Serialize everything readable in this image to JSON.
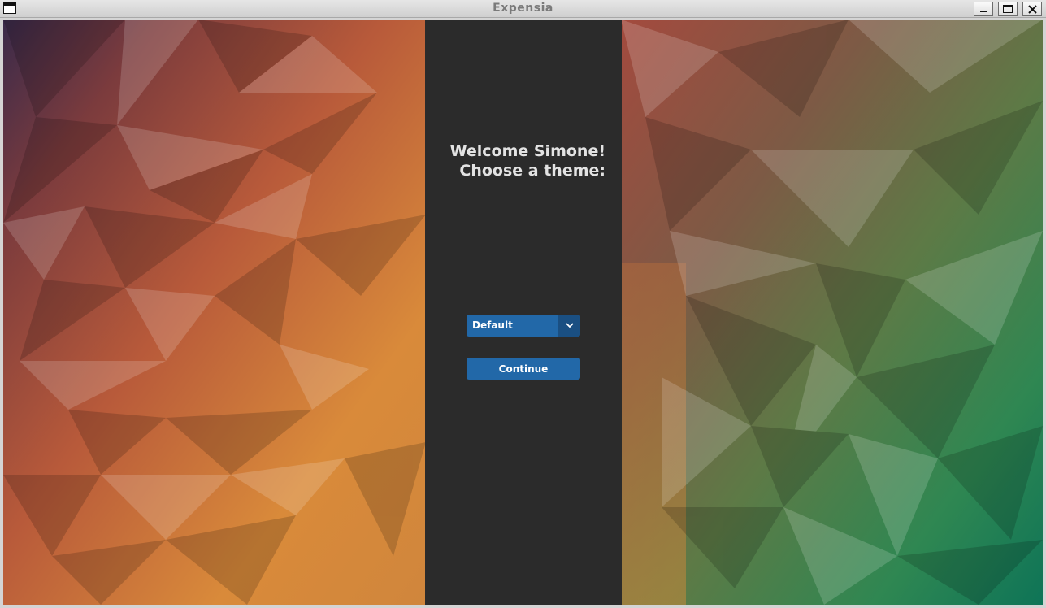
{
  "window": {
    "title": "Expensia",
    "controls": [
      "minimize-icon",
      "maximize-icon",
      "close-icon"
    ]
  },
  "welcome": {
    "line1": "Welcome Simone!",
    "line2": "Choose a theme:"
  },
  "theme_select": {
    "selected": "Default",
    "icon": "chevron-down-icon"
  },
  "continue_button": {
    "label": "Continue"
  },
  "colors": {
    "panel": "#2b2b2b",
    "accent": "#2268a8",
    "accent_dark": "#1a4f82",
    "text": "#e3e3e3"
  }
}
